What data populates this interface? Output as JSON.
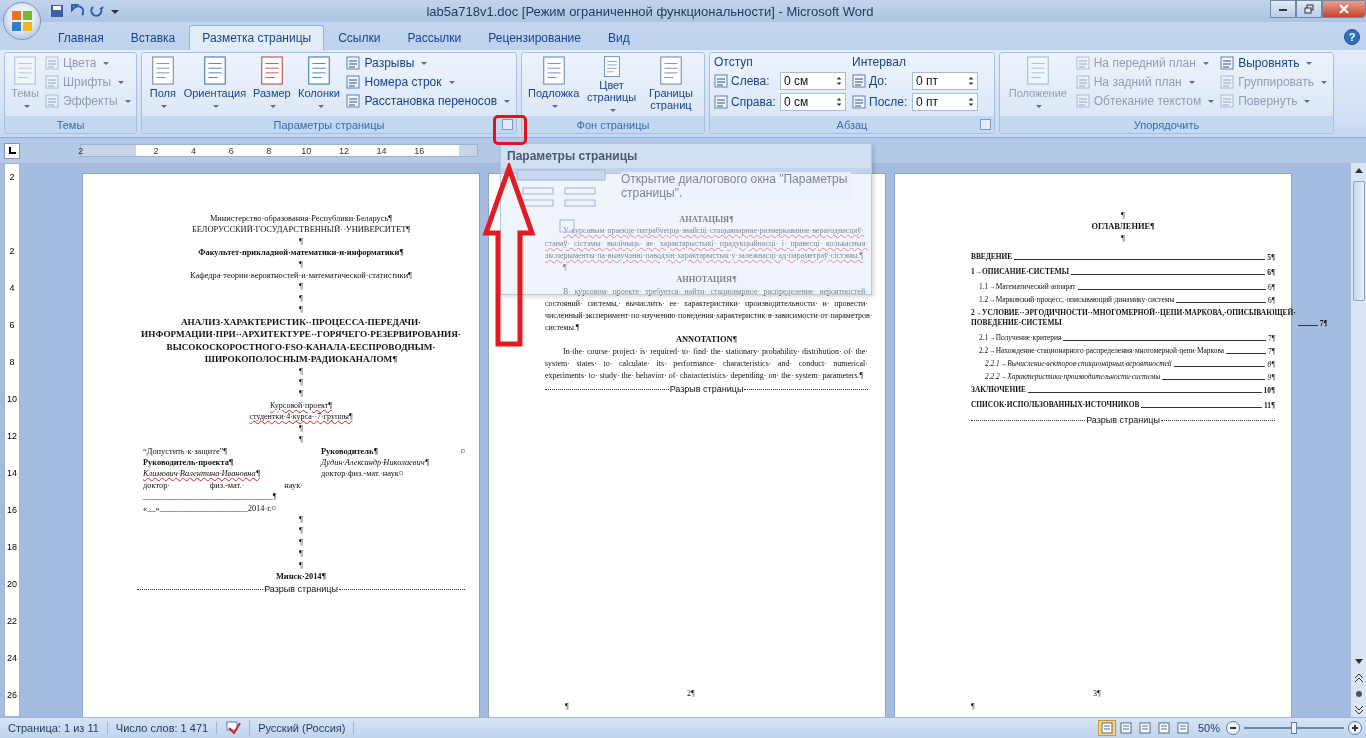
{
  "window": {
    "title": "lab5a718v1.doc [Режим ограниченной функциональности] - Microsoft Word"
  },
  "tabs": [
    {
      "label": "Главная",
      "selected": false
    },
    {
      "label": "Вставка",
      "selected": false
    },
    {
      "label": "Разметка страницы",
      "selected": true
    },
    {
      "label": "Ссылки",
      "selected": false
    },
    {
      "label": "Рассылки",
      "selected": false
    },
    {
      "label": "Рецензирование",
      "selected": false
    },
    {
      "label": "Вид",
      "selected": false
    }
  ],
  "help": "?",
  "ribbon": {
    "groups": [
      {
        "label": "Темы",
        "launcher": false,
        "columns": [
          {
            "kind": "large",
            "label": "Темы",
            "disabled": true,
            "dropdown": true
          },
          {
            "kind": "stack",
            "items": [
              {
                "label": "Цвета",
                "disabled": true
              },
              {
                "label": "Шрифты",
                "disabled": true
              },
              {
                "label": "Эффекты",
                "disabled": true
              }
            ]
          }
        ]
      },
      {
        "label": "Параметры страницы",
        "launcher": true,
        "columns": [
          {
            "kind": "large",
            "label": "Поля",
            "disabled": false,
            "dropdown": true
          },
          {
            "kind": "large",
            "label": "Ориентация",
            "disabled": false,
            "dropdown": true
          },
          {
            "kind": "large",
            "label": "Размер",
            "disabled": false,
            "dropdown": true
          },
          {
            "kind": "large",
            "label": "Колонки",
            "disabled": false,
            "dropdown": true
          },
          {
            "kind": "stack",
            "items": [
              {
                "label": "Разрывы",
                "disabled": false
              },
              {
                "label": "Номера строк",
                "disabled": false
              },
              {
                "label": "Расстановка переносов",
                "disabled": false
              }
            ]
          }
        ]
      },
      {
        "label": "Фон страницы",
        "launcher": false,
        "columns": [
          {
            "kind": "large",
            "label": "Подложка",
            "disabled": false,
            "dropdown": true
          },
          {
            "kind": "large",
            "label": "Цвет страницы",
            "disabled": false,
            "dropdown": true
          },
          {
            "kind": "large",
            "label": "Границы страниц",
            "disabled": false,
            "dropdown": false
          }
        ]
      },
      {
        "label": "Абзац",
        "launcher": true,
        "columns": [
          {
            "kind": "spins",
            "heading": "Отступ",
            "items": [
              {
                "label": "Слева:",
                "value": "0 см"
              },
              {
                "label": "Справа:",
                "value": "0 см"
              }
            ]
          },
          {
            "kind": "spins",
            "heading": "Интервал",
            "items": [
              {
                "label": "До:",
                "value": "0 пт"
              },
              {
                "label": "После:",
                "value": "0 пт"
              }
            ]
          }
        ]
      },
      {
        "label": "Упорядочить",
        "launcher": false,
        "columns": [
          {
            "kind": "large",
            "label": "Положение",
            "disabled": true,
            "dropdown": true
          },
          {
            "kind": "stack",
            "items": [
              {
                "label": "На передний план",
                "disabled": true
              },
              {
                "label": "На задний план",
                "disabled": true
              },
              {
                "label": "Обтекание текстом",
                "disabled": true
              }
            ]
          },
          {
            "kind": "stack",
            "items": [
              {
                "label": "Выровнять",
                "disabled": false
              },
              {
                "label": "Группировать",
                "disabled": true
              },
              {
                "label": "Повернуть",
                "disabled": true
              }
            ]
          }
        ]
      }
    ]
  },
  "ruler": {
    "labels": [
      "2",
      "2",
      "4",
      "6",
      "8",
      "10",
      "12",
      "14",
      "16"
    ]
  },
  "vruler": {
    "labels": [
      "2",
      "2",
      "4",
      "6",
      "8",
      "10",
      "12",
      "14",
      "16",
      "18",
      "20",
      "22",
      "24",
      "26"
    ]
  },
  "pages": [
    {
      "blocks": [
        {
          "kind": "center",
          "text": "Министерство·образования·Республики·Беларусь¶"
        },
        {
          "kind": "center",
          "text": "БЕЛОРУССКИЙ·ГОСУДАРСТВЕННЫЙ··УНИВЕРСИТЕТ¶"
        },
        {
          "kind": "center",
          "text": "¶"
        },
        {
          "kind": "center-bold",
          "text": "Факультет·прикладной·математики·и·информатики¶"
        },
        {
          "kind": "center",
          "text": "¶"
        },
        {
          "kind": "center",
          "text": "Кафедра·теории·вероятностей·и·математической·статистики¶"
        },
        {
          "kind": "center",
          "text": "¶"
        },
        {
          "kind": "center",
          "text": "¶"
        },
        {
          "kind": "center",
          "text": "¶"
        },
        {
          "kind": "heading",
          "lines": [
            "АНАЛИЗ·ХАРАКТЕРИСТИК··ПРОЦЕССА·ПЕРЕДАЧИ·",
            "ИНФОРМАЦИИ·ПРИ··АРХИТЕКТУРЕ··ГОРЯЧЕГО·РЕЗЕРВИРОВАНИЯ·",
            "ВЫСОКОСКОРОСТНОГО·FSO-КАНАЛА·БЕСПРОВОДНЫМ·",
            "ШИРОКОПОЛОСНЫМ·РАДИОКАНАЛОМ¶"
          ]
        },
        {
          "kind": "center",
          "text": "¶"
        },
        {
          "kind": "center",
          "text": "¶"
        },
        {
          "kind": "center",
          "text": "¶"
        },
        {
          "kind": "center-small",
          "misspelled": true,
          "text": "Курсовой·проект¶"
        },
        {
          "kind": "center-small",
          "misspelled": true,
          "text": "студентки·4·курса··7·группы¶"
        },
        {
          "kind": "center",
          "text": "¶"
        },
        {
          "kind": "center",
          "text": "¶"
        },
        {
          "kind": "signature",
          "row_mark": "¤",
          "left": [
            {
              "kind": "plain",
              "text": "“Допустить·к·защите”¶"
            },
            {
              "kind": "bold",
              "text": "Руководитель·проекта¶"
            },
            {
              "kind": "italic",
              "misspelled": true,
              "text": "Климович·Валентина·Ивановна¶"
            },
            {
              "kind": "spread",
              "text": "доктор· физ.-мат.· наук·"
            },
            {
              "kind": "plain",
              "text": "_______________________________¶"
            },
            {
              "kind": "plain",
              "text": "«__»_____________________2014·г.¤"
            }
          ],
          "right": [
            {
              "kind": "bold",
              "text": "Руководитель¶"
            },
            {
              "kind": "italic",
              "text": "Дудин·Александр·Николаевич¶"
            },
            {
              "kind": "plain",
              "text": "доктор·физ.-мат.·наук¤"
            }
          ]
        },
        {
          "kind": "center",
          "text": "¶"
        },
        {
          "kind": "center",
          "text": "¶"
        },
        {
          "kind": "center",
          "text": "¶"
        },
        {
          "kind": "center",
          "text": "¶"
        },
        {
          "kind": "center",
          "text": "¶"
        },
        {
          "kind": "center-bold",
          "text": "Минск·2014¶"
        },
        {
          "kind": "break",
          "text": "Разрыв страницы"
        }
      ]
    },
    {
      "footer": {
        "number": "2¶",
        "mark": "¶"
      },
      "blocks": [
        {
          "kind": "center-bold",
          "text": "АНАТАЦЫЯ¶"
        },
        {
          "kind": "justify",
          "misspelled": true,
          "text": "У·курсавым·праекце·патрабуецца·знайсці·стацыянарнае·размеркаванне·верагоднасцяў· станаў· сістэмы· вылічыць· яе· характарыстыкі· прадукцыйнасці· і· правесці· колькасныя· эксперыменты·па·вывучэнні·паводзін·характарыстык·у·залежнасці·ад·параметраў·сістэмы.¶"
        },
        {
          "kind": "justify",
          "text": "¶"
        },
        {
          "kind": "center-bold",
          "text": "АННОТАЦИЯ¶"
        },
        {
          "kind": "justify",
          "text": "В· курсовом· проекте· требуется· найти· стационарное· распределение· вероятностей· состояний· системы,· вычислить· ее· характеристики· производительности· и· провести· численный·эксперимент·по·изучению·поведения·характеристик·в·зависимости·от·параметров· системы.¶"
        },
        {
          "kind": "center-bold",
          "text": "ANNOTATION¶"
        },
        {
          "kind": "justify",
          "text": "In·the· course· project· is· required· to· find· the· stationary· probability· distribution· of· the· system· states· to· calculate· its· performance· characteristics· and· conduct· numerical· experiments· to· study· the· behavior· of· characteristics· depending· on· the· system· parameters.¶"
        },
        {
          "kind": "break",
          "text": "Разрыв страницы"
        }
      ]
    },
    {
      "footer": {
        "number": "3¶",
        "mark": "¶"
      },
      "blocks": [
        {
          "kind": "center",
          "text": "¶"
        },
        {
          "kind": "center-bold",
          "text": "ОГЛАВЛЕНИЕ¶"
        },
        {
          "kind": "center",
          "text": "¶"
        },
        {
          "kind": "toc",
          "entries": [
            {
              "label": "ВВЕДЕНИЕ",
              "page": "5¶"
            },
            {
              "label": "1→ОПИСАНИЕ·СИСТЕМЫ",
              "page": "6¶",
              "children": [
                {
                  "label": "1.1→Математический·аппарат",
                  "page": "6¶"
                },
                {
                  "label": "1.2→Марковский·процесс,·описывающий·динамику·системы",
                  "page": "6¶"
                }
              ]
            },
            {
              "label": "2→УСЛОВИЕ··ЭРГОДИЧНОСТИ··МНОГОМЕРНОЙ··ЦЕПИ·МАРКОВА,·ОПИСЫВАЮЩЕЙ· ПОВЕДЕНИЕ·СИСТЕМЫ",
              "page": "7¶",
              "children": [
                {
                  "label": "2.1→Получение·критерия",
                  "page": "7¶"
                },
                {
                  "label": "2.2→Нахождение·стационарного·распределения·многомерной·цепи·Маркова",
                  "page": "7¶",
                  "children": [
                    {
                      "label": "2.2.1→Вычисление·векторов·стационарных·вероятностей",
                      "page": "8¶"
                    },
                    {
                      "label": "2.2.2→Характеристики·производительности·системы",
                      "page": "9¶"
                    }
                  ]
                }
              ]
            },
            {
              "label": "ЗАКЛЮЧЕНИЕ",
              "page": "10¶"
            },
            {
              "label": "СПИСОК·ИСПОЛЬЗОВАННЫХ·ИСТОЧНИКОВ",
              "page": "11¶"
            }
          ]
        },
        {
          "kind": "break",
          "text": "Разрыв страницы"
        }
      ]
    }
  ],
  "tooltip": {
    "title": "Параметры страницы",
    "description": "Открытие диалогового окна \"Параметры страницы\"."
  },
  "status_bar": {
    "page": "Страница: 1 из 11",
    "words": "Число слов: 1 471",
    "language": "Русский (Россия)",
    "views": [
      {
        "selected": true
      },
      {
        "selected": false
      },
      {
        "selected": false
      },
      {
        "selected": false
      },
      {
        "selected": false
      }
    ],
    "zoom": "50%",
    "zoom_slider": {
      "level": 0.5
    }
  }
}
